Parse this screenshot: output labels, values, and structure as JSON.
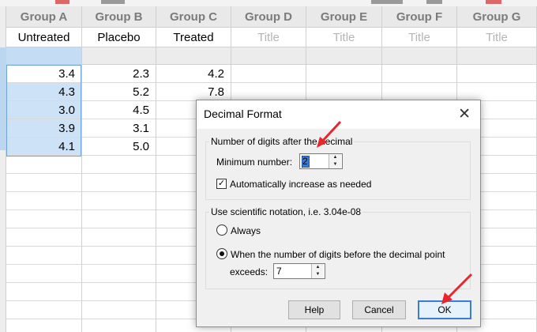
{
  "columns": [
    {
      "header": "Group A",
      "title": "Untreated",
      "title_is_placeholder": false,
      "values": [
        "3.4",
        "4.3",
        "3.0",
        "3.9",
        "4.1"
      ]
    },
    {
      "header": "Group B",
      "title": "Placebo",
      "title_is_placeholder": false,
      "values": [
        "2.3",
        "5.2",
        "4.5",
        "3.1",
        "5.0"
      ]
    },
    {
      "header": "Group C",
      "title": "Treated",
      "title_is_placeholder": false,
      "values": [
        "4.2",
        "7.8"
      ]
    },
    {
      "header": "Group D",
      "title": "Title",
      "title_is_placeholder": true,
      "values": []
    },
    {
      "header": "Group E",
      "title": "Title",
      "title_is_placeholder": true,
      "values": []
    },
    {
      "header": "Group F",
      "title": "Title",
      "title_is_placeholder": true,
      "values": []
    },
    {
      "header": "Group G",
      "title": "Title",
      "title_is_placeholder": true,
      "values": []
    }
  ],
  "dialog": {
    "title": "Decimal Format",
    "close_glyph": "✕",
    "digits_group": {
      "legend": "Number of digits after the decimal",
      "min_label": "Minimum number:",
      "min_value": "2",
      "auto_label": "Automatically increase as needed",
      "auto_checked": true
    },
    "sci_group": {
      "legend": "Use scientific notation,  i.e. 3.04e-08",
      "always_label": "Always",
      "when_label": "When the number of digits before the decimal point",
      "exceeds_label": "exceeds:",
      "exceeds_value": "7",
      "selected": "when"
    },
    "buttons": {
      "help": "Help",
      "cancel": "Cancel",
      "ok": "OK"
    }
  },
  "colors": {
    "accent": "#3d7bd9",
    "annotation_arrow": "#e8262b",
    "selection": "#cde2f6"
  },
  "icons": {
    "check": "check-icon",
    "spin_up": "chevron-up-icon",
    "spin_down": "chevron-down-icon"
  }
}
